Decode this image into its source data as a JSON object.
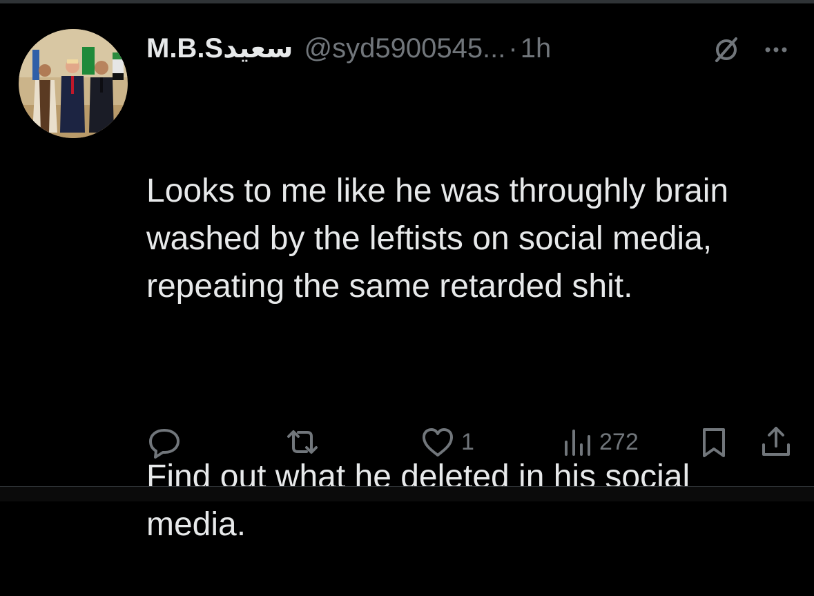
{
  "tweet": {
    "display_name": "M.B.Sسعيد",
    "handle": "@syd5900545...",
    "separator": "·",
    "time": "1h",
    "paragraphs": [
      "Looks to me like he was throughly brain washed by the leftists on social media, repeating the same retarded shit.",
      "Find out what he deleted in his social media."
    ]
  },
  "actions": {
    "reply_count": "",
    "repost_count": "",
    "like_count": "1",
    "views_count": "272"
  },
  "icons": {
    "avatar": "profile-photo",
    "grok": "grok-icon",
    "more": "more-icon",
    "reply": "reply-icon",
    "repost": "repost-icon",
    "like": "heart-icon",
    "views": "views-icon",
    "bookmark": "bookmark-icon",
    "share": "share-icon"
  },
  "colors": {
    "background": "#000000",
    "text": "#e7e9ea",
    "secondary": "#71767b",
    "divider": "#2f3336"
  }
}
